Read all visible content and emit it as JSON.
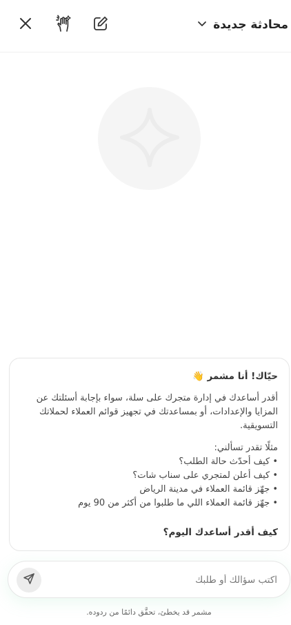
{
  "header": {
    "title": "محادثة جديدة"
  },
  "message": {
    "greeting": "حيّاك! أنا مشمر 👋",
    "intro": "أقدر أساعدك في إدارة متجرك على سلة، سواء بإجابة أسئلتك عن المزايا والإعدادات، أو بمساعدتك في تجهيز قوائم العملاء لحملاتك التسويقية.",
    "examples_title": "مثلًا تقدر تسألني:",
    "examples": [
      "كيف أحدّث حالة الطلب؟",
      "كيف أعلن لمتجري على سناب شات؟",
      "جهّز قائمة العملاء في مدينة الرياض",
      "جهّز قائمة العملاء اللي ما طلبوا من أكثر من 90 يوم"
    ],
    "closing": "كيف أقدر أساعدك اليوم؟"
  },
  "composer": {
    "placeholder": "اكتب سؤالك أو طلبك"
  },
  "footer": {
    "disclaimer": "مشمر قد يخطئ، تحقَّق دائمًا من ردوده."
  },
  "icons": {
    "close": "close-icon",
    "gesture": "hand-sparkle-icon",
    "edit": "edit-icon",
    "dropdown": "chevron-down-icon",
    "logo": "sparkle-star-icon",
    "send": "send-icon"
  },
  "colors": {
    "border": "#e6e6e6",
    "logo_bg": "#f5f5f5",
    "send_bg": "#ececec"
  }
}
